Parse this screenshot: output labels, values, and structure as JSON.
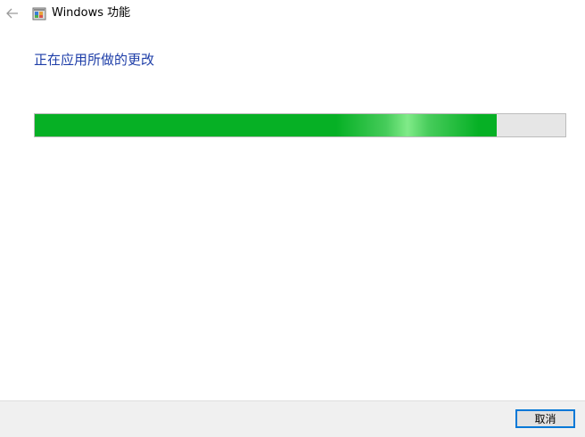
{
  "window": {
    "title": "Windows 功能"
  },
  "main": {
    "heading": "正在应用所做的更改",
    "progress_fraction": 0.87
  },
  "footer": {
    "cancel_label": "取消"
  },
  "icons": {
    "back": "back-arrow-icon",
    "app": "windows-features-icon"
  },
  "colors": {
    "heading": "#1e3ea8",
    "progress_fill": "#06b025",
    "progress_track": "#e6e6e6",
    "button_focus_border": "#0078d7",
    "footer_background": "#f0f0f0"
  }
}
